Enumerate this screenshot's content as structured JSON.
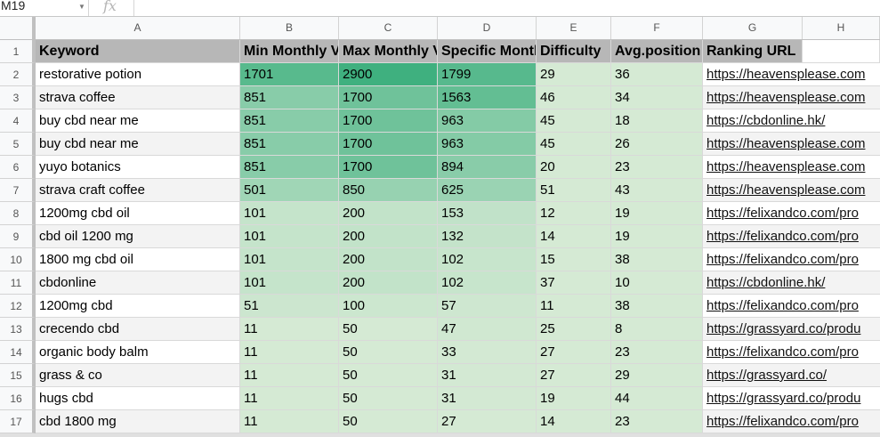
{
  "formula_bar": {
    "name_box": "M19",
    "fx_label": "fx"
  },
  "columns": [
    "A",
    "B",
    "C",
    "D",
    "E",
    "F",
    "G",
    "H"
  ],
  "header": {
    "row_number": "1",
    "cells": [
      "Keyword",
      "Min Monthly V",
      "Max Monthly V",
      "Specific Month",
      "Difficulty",
      "Avg.position",
      "Ranking URL",
      ""
    ]
  },
  "colors": {
    "row_even": "#f3f3f3",
    "row_odd": "#ffffff",
    "green_light": "#d5ead4",
    "green_med": "#9fd5b1",
    "green_strong": "#72c49a",
    "green_darkest": "#3fb07f",
    "header_gray": "#b7b7b7"
  },
  "rows": [
    {
      "n": "2",
      "keyword": "restorative potion",
      "min": "1701",
      "max": "2900",
      "spec": "1799",
      "diff": "29",
      "pos": "36",
      "url": "https://heavensplease.com"
    },
    {
      "n": "3",
      "keyword": "strava coffee",
      "min": "851",
      "max": "1700",
      "spec": "1563",
      "diff": "46",
      "pos": "34",
      "url": "https://heavensplease.com"
    },
    {
      "n": "4",
      "keyword": "buy cbd near me",
      "min": "851",
      "max": "1700",
      "spec": "963",
      "diff": "45",
      "pos": "18",
      "url": "https://cbdonline.hk/"
    },
    {
      "n": "5",
      "keyword": "buy cbd near me",
      "min": "851",
      "max": "1700",
      "spec": "963",
      "diff": "45",
      "pos": "26",
      "url": "https://heavensplease.com"
    },
    {
      "n": "6",
      "keyword": "yuyo botanics",
      "min": "851",
      "max": "1700",
      "spec": "894",
      "diff": "20",
      "pos": "23",
      "url": "https://heavensplease.com"
    },
    {
      "n": "7",
      "keyword": "strava craft coffee",
      "min": "501",
      "max": "850",
      "spec": "625",
      "diff": "51",
      "pos": "43",
      "url": "https://heavensplease.com"
    },
    {
      "n": "8",
      "keyword": "1200mg cbd oil",
      "min": "101",
      "max": "200",
      "spec": "153",
      "diff": "12",
      "pos": "19",
      "url": "https://felixandco.com/pro"
    },
    {
      "n": "9",
      "keyword": "cbd oil 1200 mg",
      "min": "101",
      "max": "200",
      "spec": "132",
      "diff": "14",
      "pos": "19",
      "url": "https://felixandco.com/pro"
    },
    {
      "n": "10",
      "keyword": "1800 mg cbd oil",
      "min": "101",
      "max": "200",
      "spec": "102",
      "diff": "15",
      "pos": "38",
      "url": "https://felixandco.com/pro"
    },
    {
      "n": "11",
      "keyword": "cbdonline",
      "min": "101",
      "max": "200",
      "spec": "102",
      "diff": "37",
      "pos": "10",
      "url": "https://cbdonline.hk/"
    },
    {
      "n": "12",
      "keyword": "1200mg cbd",
      "min": "51",
      "max": "100",
      "spec": "57",
      "diff": "11",
      "pos": "38",
      "url": "https://felixandco.com/pro"
    },
    {
      "n": "13",
      "keyword": "crecendo cbd",
      "min": "11",
      "max": "50",
      "spec": "47",
      "diff": "25",
      "pos": "8",
      "url": "https://grassyard.co/produ"
    },
    {
      "n": "14",
      "keyword": "organic body balm",
      "min": "11",
      "max": "50",
      "spec": "33",
      "diff": "27",
      "pos": "23",
      "url": "https://felixandco.com/pro"
    },
    {
      "n": "15",
      "keyword": "grass & co",
      "min": "11",
      "max": "50",
      "spec": "31",
      "diff": "27",
      "pos": "29",
      "url": "https://grassyard.co/"
    },
    {
      "n": "16",
      "keyword": "hugs cbd",
      "min": "11",
      "max": "50",
      "spec": "31",
      "diff": "19",
      "pos": "44",
      "url": "https://grassyard.co/produ"
    },
    {
      "n": "17",
      "keyword": "cbd 1800 mg",
      "min": "11",
      "max": "50",
      "spec": "27",
      "diff": "14",
      "pos": "23",
      "url": "https://felixandco.com/pro"
    }
  ]
}
